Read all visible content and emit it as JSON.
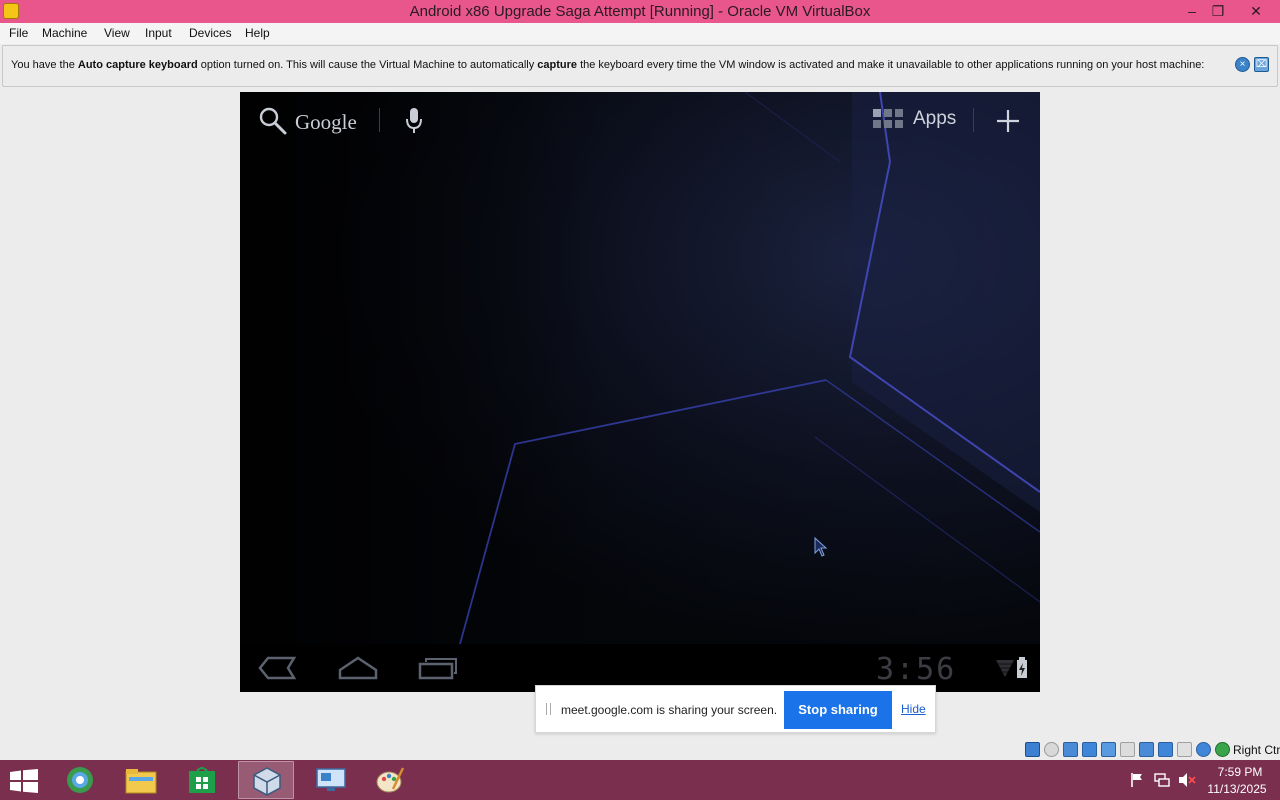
{
  "window": {
    "title": "Android x86 Upgrade Saga Attempt [Running] - Oracle VM VirtualBox",
    "minimize_glyph": "–",
    "restore_glyph": "❐",
    "close_glyph": "✕"
  },
  "menu": {
    "items": [
      {
        "label": "File"
      },
      {
        "label": "Machine"
      },
      {
        "label": "View"
      },
      {
        "label": "Input"
      },
      {
        "label": "Devices"
      },
      {
        "label": "Help"
      }
    ]
  },
  "notice": {
    "part1": "You have the ",
    "bold1": "Auto capture keyboard",
    "part2": " option turned on. This will cause the Virtual Machine to automatically ",
    "bold2": "capture",
    "part3": " the keyboard every time the VM window is activated and make it unavailable to other applications running on your host machine:"
  },
  "android": {
    "search_label": "Google",
    "apps_label": "Apps",
    "clock": "3:56"
  },
  "share": {
    "message": "meet.google.com is sharing your screen.",
    "stop_label": "Stop sharing",
    "hide_label": "Hide"
  },
  "vbox_status": {
    "host_key": "Right Ctrl"
  },
  "taskbar": {
    "time": "7:59 PM",
    "date": "11/13/2025"
  },
  "colors": {
    "titlebar": "#e8568c",
    "taskbar": "#7a2f4e",
    "share_button": "#1a73e8"
  }
}
